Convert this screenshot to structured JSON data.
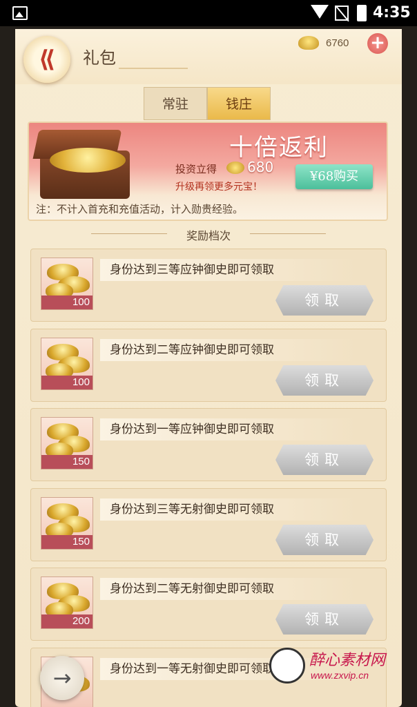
{
  "statusbar": {
    "time": "4:35"
  },
  "header": {
    "title": "礼包",
    "back_icon": "back-arrow-icon",
    "gold": "6760",
    "add_label": "+"
  },
  "tabs": [
    {
      "label": "常驻"
    },
    {
      "label": "钱庄"
    }
  ],
  "banner": {
    "title": "十倍返利",
    "invest_label": "投资立得",
    "invest_value": "680",
    "upgrade_text": "升级再领更多元宝！",
    "buy_label": "¥68购买",
    "note": "注：不计入首充和充值活动，计入勋贵经验。"
  },
  "section_title": "奖励档次",
  "rewards": [
    {
      "desc": "身份达到三等应钟御史即可领取",
      "amount": "100",
      "claim": "领取"
    },
    {
      "desc": "身份达到二等应钟御史即可领取",
      "amount": "100",
      "claim": "领取"
    },
    {
      "desc": "身份达到一等应钟御史即可领取",
      "amount": "150",
      "claim": "领取"
    },
    {
      "desc": "身份达到三等无射御史即可领取",
      "amount": "150",
      "claim": "领取"
    },
    {
      "desc": "身份达到二等无射御史即可领取",
      "amount": "200",
      "claim": "领取"
    },
    {
      "desc": "身份达到一等无射御史即可领取",
      "amount": "",
      "claim": ""
    }
  ],
  "next_button": "→",
  "watermark": {
    "cn": "醉心素材网",
    "url": "www.zxvip.cn"
  }
}
